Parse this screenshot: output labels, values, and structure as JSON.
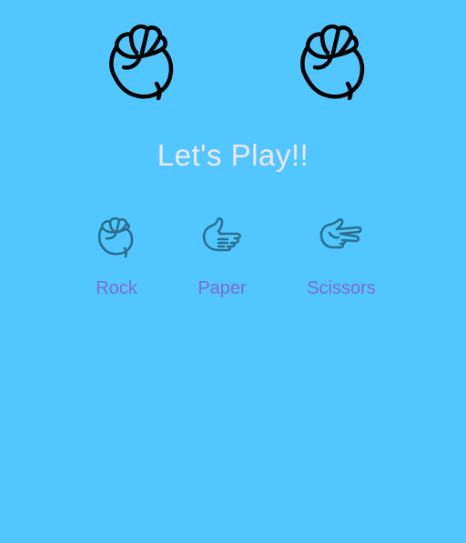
{
  "game": {
    "title": "Let's Play!!"
  },
  "players": {
    "left_hand_icon": "fist-icon",
    "right_hand_icon": "fist-icon"
  },
  "choices": [
    {
      "label": "Rock",
      "icon": "rock-fist-icon"
    },
    {
      "label": "Paper",
      "icon": "paper-hand-icon"
    },
    {
      "label": "Scissors",
      "icon": "scissors-hand-icon"
    }
  ],
  "colors": {
    "background": "#52c7ff",
    "title": "#f1e6ff",
    "choice_label": "#7d6bd8",
    "choice_icon": "#2b6f8e"
  }
}
